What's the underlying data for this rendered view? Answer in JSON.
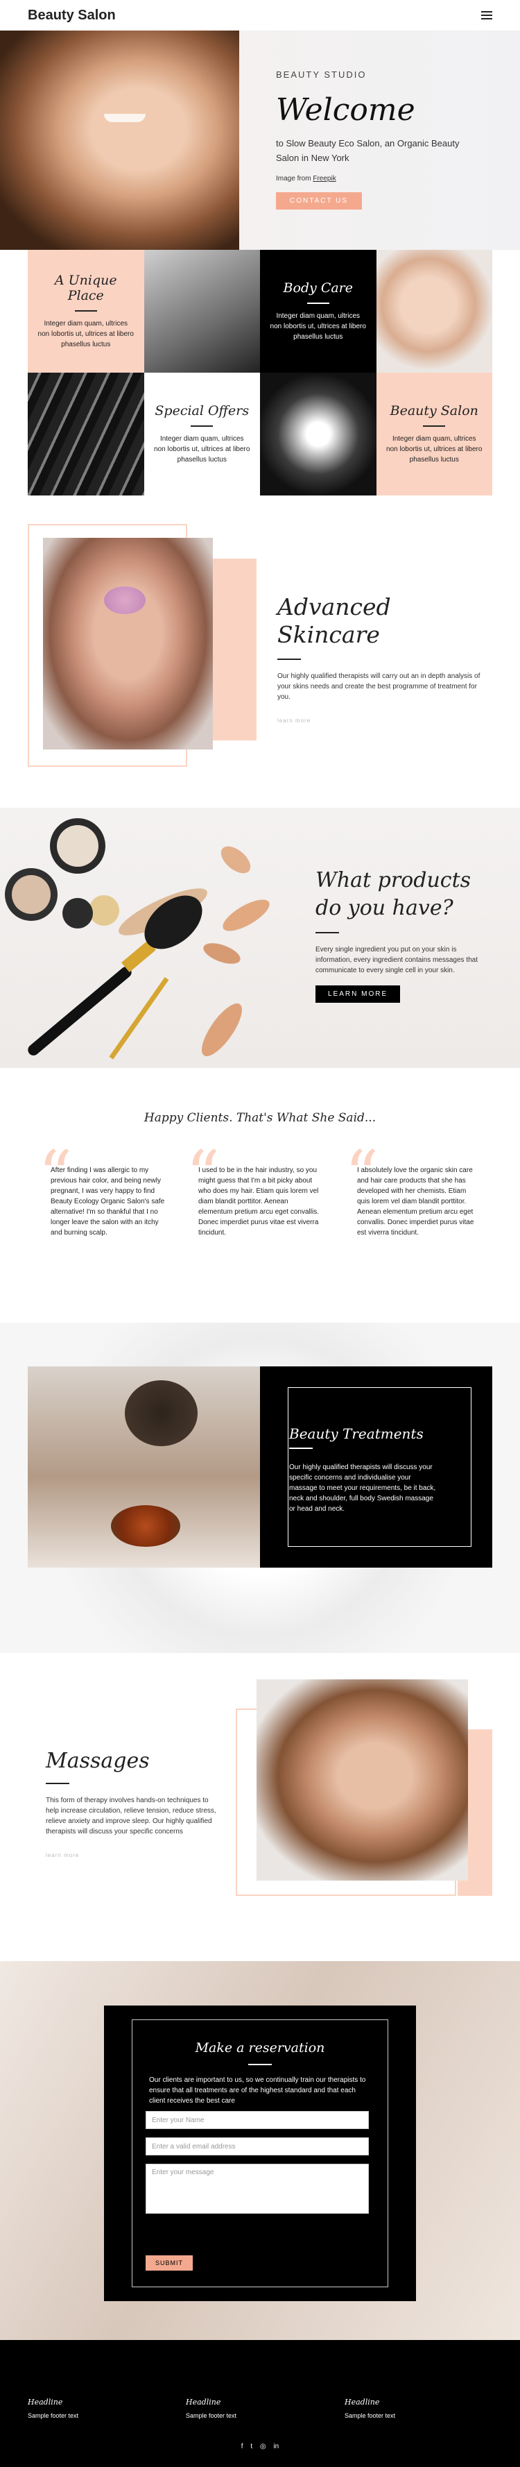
{
  "header": {
    "logo": "Beauty Salon",
    "menu_icon": "hamburger-icon"
  },
  "hero": {
    "eyebrow": "BEAUTY STUDIO",
    "title": "Welcome",
    "text": "to Slow Beauty Eco Salon, an Organic Beauty Salon in New York",
    "credit_prefix": "Image from",
    "credit_link": "Freepik",
    "cta": "CONTACT US"
  },
  "features": [
    {
      "title": "A Unique Place",
      "text": "Integer diam quam, ultrices non lobortis ut, ultrices at libero phasellus luctus"
    },
    {
      "title": "Body Care",
      "text": "Integer diam quam, ultrices non lobortis ut, ultrices at libero phasellus luctus"
    },
    {
      "title": "Special Offers",
      "text": "Integer diam quam, ultrices non lobortis ut, ultrices at libero phasellus luctus"
    },
    {
      "title": "Beauty Salon",
      "text": "Integer diam quam, ultrices non lobortis ut, ultrices at libero phasellus luctus"
    }
  ],
  "skincare": {
    "title": "Advanced Skincare",
    "text": "Our highly qualified therapists will carry out an in depth analysis of your skins needs and create the best programme of treatment for you.",
    "link": "learn more"
  },
  "products": {
    "title": "What products do you have?",
    "text": "Every single ingredient you put on your skin is information, every ingredient contains messages that communicate to every single cell in your skin.",
    "cta": "LEARN MORE"
  },
  "testimonials": {
    "title": "Happy Clients. That's What She Said...",
    "items": [
      {
        "text": "After finding I was allergic to my previous hair color, and being newly pregnant, I was very happy to find Beauty Ecology Organic Salon's safe alternative! I'm so thankful that I no longer leave the salon with an itchy and burning scalp."
      },
      {
        "text": "I used to be in the hair industry, so you might guess that I'm a bit picky about who does my hair. Etiam quis lorem vel diam blandit porttitor. Aenean elementum pretium arcu eget convallis. Donec imperdiet purus vitae est viverra tincidunt."
      },
      {
        "text": "I absolutely love the organic skin care and hair care products that she has developed with her chemists. Etiam quis lorem vel diam blandit porttitor. Aenean elementum pretium arcu eget convallis. Donec imperdiet purus vitae est viverra tincidunt."
      }
    ]
  },
  "treatments": {
    "title": "Beauty Treatments",
    "text": "Our highly qualified therapists will discuss your specific concerns and individualise your massage to meet your requirements, be it back, neck and shoulder, full body Swedish massage or head and neck."
  },
  "massages": {
    "title": "Massages",
    "text": "This form of therapy involves hands-on techniques to help increase circulation, relieve tension, reduce stress, relieve anxiety and improve sleep. Our highly qualified therapists will discuss your specific concerns",
    "link": "learn more"
  },
  "reservation": {
    "title": "Make a reservation",
    "text": "Our clients are important to us, so we continually train our therapists to ensure that all treatments are of the highest standard and that each client receives the best care",
    "name_ph": "Enter your Name",
    "email_ph": "Enter a valid email address",
    "message_ph": "Enter your message",
    "submit": "SUBMIT"
  },
  "footer": {
    "cols": [
      {
        "heading": "Headline",
        "text": "Sample footer text"
      },
      {
        "heading": "Headline",
        "text": "Sample footer text"
      },
      {
        "heading": "Headline",
        "text": "Sample footer text"
      }
    ],
    "social": [
      {
        "icon": "facebook-icon",
        "glyph": "f"
      },
      {
        "icon": "twitter-icon",
        "glyph": "t"
      },
      {
        "icon": "instagram-icon",
        "glyph": "◎"
      },
      {
        "icon": "linkedin-icon",
        "glyph": "in"
      }
    ]
  },
  "colors": {
    "accent": "#f4a98e",
    "peach": "#fbd3c2",
    "black": "#000000"
  }
}
